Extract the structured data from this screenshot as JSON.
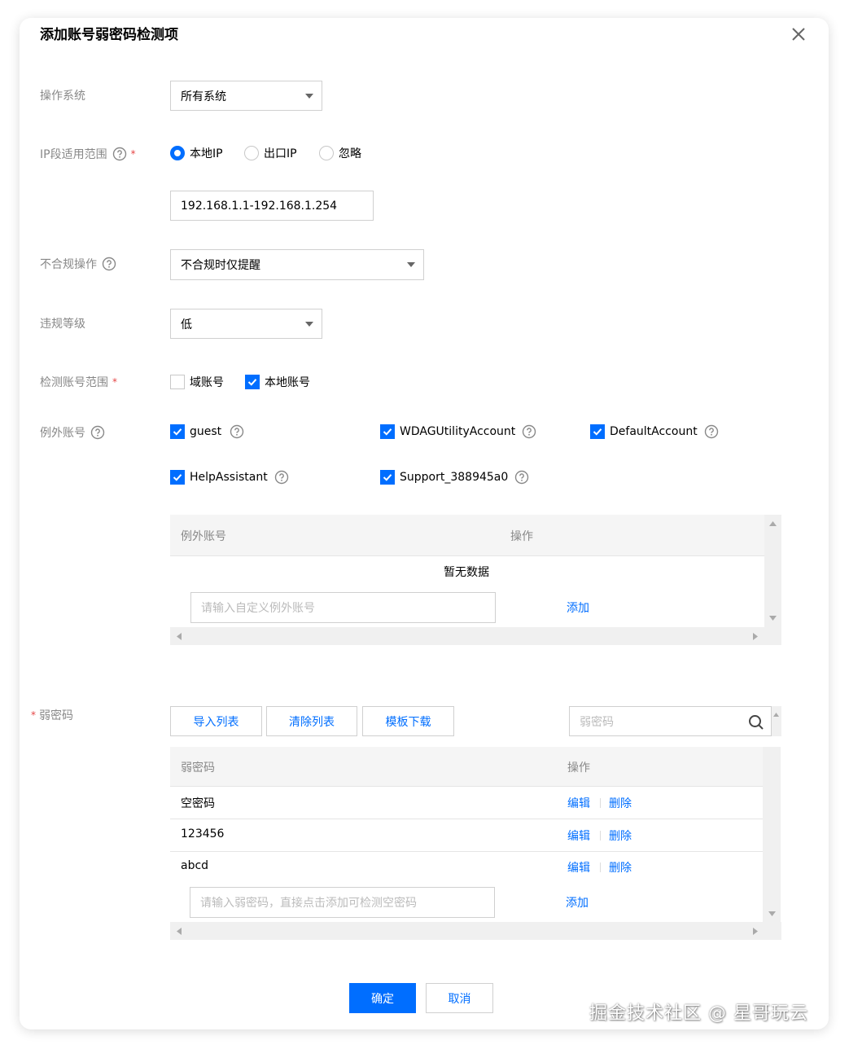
{
  "dialog": {
    "title": "添加账号弱密码检测项",
    "close_icon": "close-icon"
  },
  "os": {
    "label": "操作系统",
    "value": "所有系统"
  },
  "ip_scope": {
    "label": "IP段适用范围",
    "required_mark": "*",
    "options": [
      "本地IP",
      "出口IP",
      "忽略"
    ],
    "selected": "本地IP",
    "value": "192.168.1.1-192.168.1.254"
  },
  "noncompliance": {
    "label": "不合规操作",
    "value": "不合规时仅提醒"
  },
  "level": {
    "label": "违规等级",
    "value": "低"
  },
  "account_scope": {
    "label": "检测账号范围",
    "required_mark": "*",
    "options": [
      {
        "label": "域账号",
        "checked": false
      },
      {
        "label": "本地账号",
        "checked": true
      }
    ]
  },
  "exception_accounts": {
    "label": "例外账号",
    "items": [
      {
        "label": "guest",
        "checked": true
      },
      {
        "label": "WDAGUtilityAccount",
        "checked": true
      },
      {
        "label": "DefaultAccount",
        "checked": true
      },
      {
        "label": "HelpAssistant",
        "checked": true
      },
      {
        "label": "Support_388945a0",
        "checked": true
      }
    ],
    "table": {
      "col_account": "例外账号",
      "col_action": "操作",
      "empty": "暂无数据",
      "input_placeholder": "请输入自定义例外账号",
      "add": "添加"
    }
  },
  "weak_password": {
    "label": "弱密码",
    "required_mark": "*",
    "buttons": {
      "import": "导入列表",
      "clear": "清除列表",
      "template": "模板下载"
    },
    "search_placeholder": "弱密码",
    "table": {
      "col_password": "弱密码",
      "col_action": "操作",
      "rows": [
        {
          "password": "空密码",
          "edit": "编辑",
          "delete": "删除"
        },
        {
          "password": "123456",
          "edit": "编辑",
          "delete": "删除"
        },
        {
          "password": "abcd",
          "edit": "编辑",
          "delete": "删除"
        }
      ],
      "input_placeholder": "请输入弱密码，直接点击添加可检测空密码",
      "add": "添加"
    }
  },
  "footer": {
    "confirm": "确定",
    "cancel": "取消"
  },
  "watermark": "掘金技术社区 @ 星哥玩云",
  "colors": {
    "primary": "#006eff",
    "required": "#e54545",
    "label": "#888888"
  }
}
